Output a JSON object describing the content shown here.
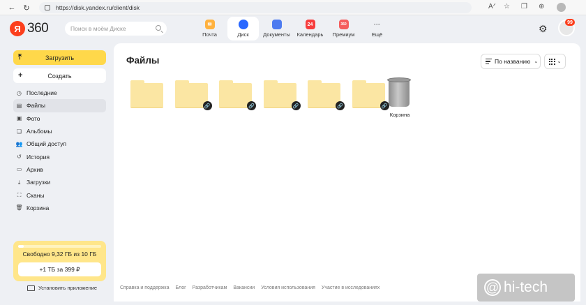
{
  "browser": {
    "url": "https://disk.yandex.ru/client/disk",
    "icons": [
      "back-arrow",
      "refresh",
      "lock",
      "reader-mode",
      "favorite",
      "collections",
      "extensions",
      "profile"
    ]
  },
  "header": {
    "logo_ya": "Я",
    "logo_360": "360",
    "search_placeholder": "Поиск в моём Диске",
    "services": [
      {
        "label": "Почта",
        "color": "#ffa51d"
      },
      {
        "label": "Диск",
        "color": "#2867ff"
      },
      {
        "label": "Документы",
        "color": "#4d7bf0"
      },
      {
        "label": "Календарь",
        "color": "#f73d3d",
        "badge": "24"
      },
      {
        "label": "Премиум",
        "color": "#f45d5d",
        "badge": "360"
      },
      {
        "label": "Ещё",
        "icon": "···"
      }
    ],
    "avatar_badge": "99"
  },
  "sidebar": {
    "upload_label": "Загрузить",
    "create_label": "Создать",
    "items": [
      {
        "label": "Последние",
        "icon": "clock"
      },
      {
        "label": "Файлы",
        "icon": "file"
      },
      {
        "label": "Фото",
        "icon": "photo"
      },
      {
        "label": "Альбомы",
        "icon": "albums"
      },
      {
        "label": "Общий доступ",
        "icon": "users"
      },
      {
        "label": "История",
        "icon": "history"
      },
      {
        "label": "Архив",
        "icon": "archive"
      },
      {
        "label": "Загрузки",
        "icon": "download"
      },
      {
        "label": "Сканы",
        "icon": "scan"
      },
      {
        "label": "Корзина",
        "icon": "trash"
      }
    ],
    "storage_text": "Свободно 9,32 ГБ из 10 ГБ",
    "storage_used_fraction": 0.07,
    "storage_button": "+1 ТБ за 399 ₽",
    "install_label": "Установить приложение"
  },
  "main": {
    "title": "Файлы",
    "sort_label": "По названию",
    "folders": [
      {
        "shared": false
      },
      {
        "shared": true
      },
      {
        "shared": true
      },
      {
        "shared": true
      },
      {
        "shared": true
      },
      {
        "shared": true
      }
    ],
    "trash_label": "Корзина"
  },
  "footer": {
    "links": [
      "Справка и поддержка",
      "Блог",
      "Разработчикам",
      "Вакансии",
      "Условия использования",
      "Участие в исследованиях"
    ]
  },
  "watermark": "hi-tech"
}
